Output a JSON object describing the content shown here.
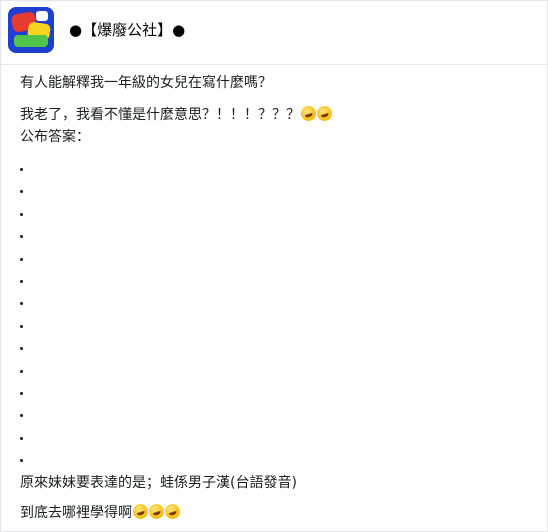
{
  "post": {
    "page_name": "●【爆廢公社】●",
    "line1": "有人能解釋我一年級的女兒在寫什麼嗎？",
    "line2": "我老了，我看不懂是什麼意思？！！！？？？",
    "line3": "公布答案：",
    "dots": [
      ".",
      ".",
      ".",
      ".",
      ".",
      ".",
      ".",
      ".",
      ".",
      ".",
      ".",
      ".",
      ".",
      "."
    ],
    "answer": "原來妹妹要表達的是；蛙係男子漢(台語發音)",
    "line_last": "到底去哪裡學得啊"
  },
  "icons": {
    "avatar": "page-logo-avatar",
    "emoji": "rolling-on-floor-laughing-emoji"
  }
}
